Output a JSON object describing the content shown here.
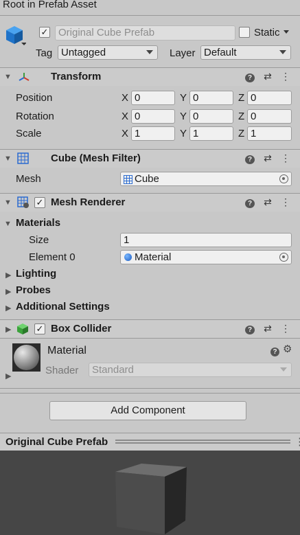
{
  "top_title": "Root in Prefab Asset",
  "object": {
    "name": "Original Cube Prefab",
    "static_label": "Static",
    "tag_label": "Tag",
    "tag_value": "Untagged",
    "layer_label": "Layer",
    "layer_value": "Default"
  },
  "transform": {
    "title": "Transform",
    "rows": [
      {
        "label": "Position",
        "x": "0",
        "y": "0",
        "z": "0"
      },
      {
        "label": "Rotation",
        "x": "0",
        "y": "0",
        "z": "0"
      },
      {
        "label": "Scale",
        "x": "1",
        "y": "1",
        "z": "1"
      }
    ],
    "axis_x": "X",
    "axis_y": "Y",
    "axis_z": "Z"
  },
  "mesh_filter": {
    "title": "Cube (Mesh Filter)",
    "mesh_label": "Mesh",
    "mesh_value": "Cube"
  },
  "mesh_renderer": {
    "title": "Mesh Renderer",
    "materials_label": "Materials",
    "size_label": "Size",
    "size_value": "1",
    "element_label": "Element 0",
    "element_value": "Material",
    "lighting": "Lighting",
    "probes": "Probes",
    "additional": "Additional Settings"
  },
  "box_collider": {
    "title": "Box Collider"
  },
  "material": {
    "name": "Material",
    "shader_label": "Shader",
    "shader_value": "Standard"
  },
  "add_component": "Add Component",
  "preview_title": "Original Cube Prefab"
}
